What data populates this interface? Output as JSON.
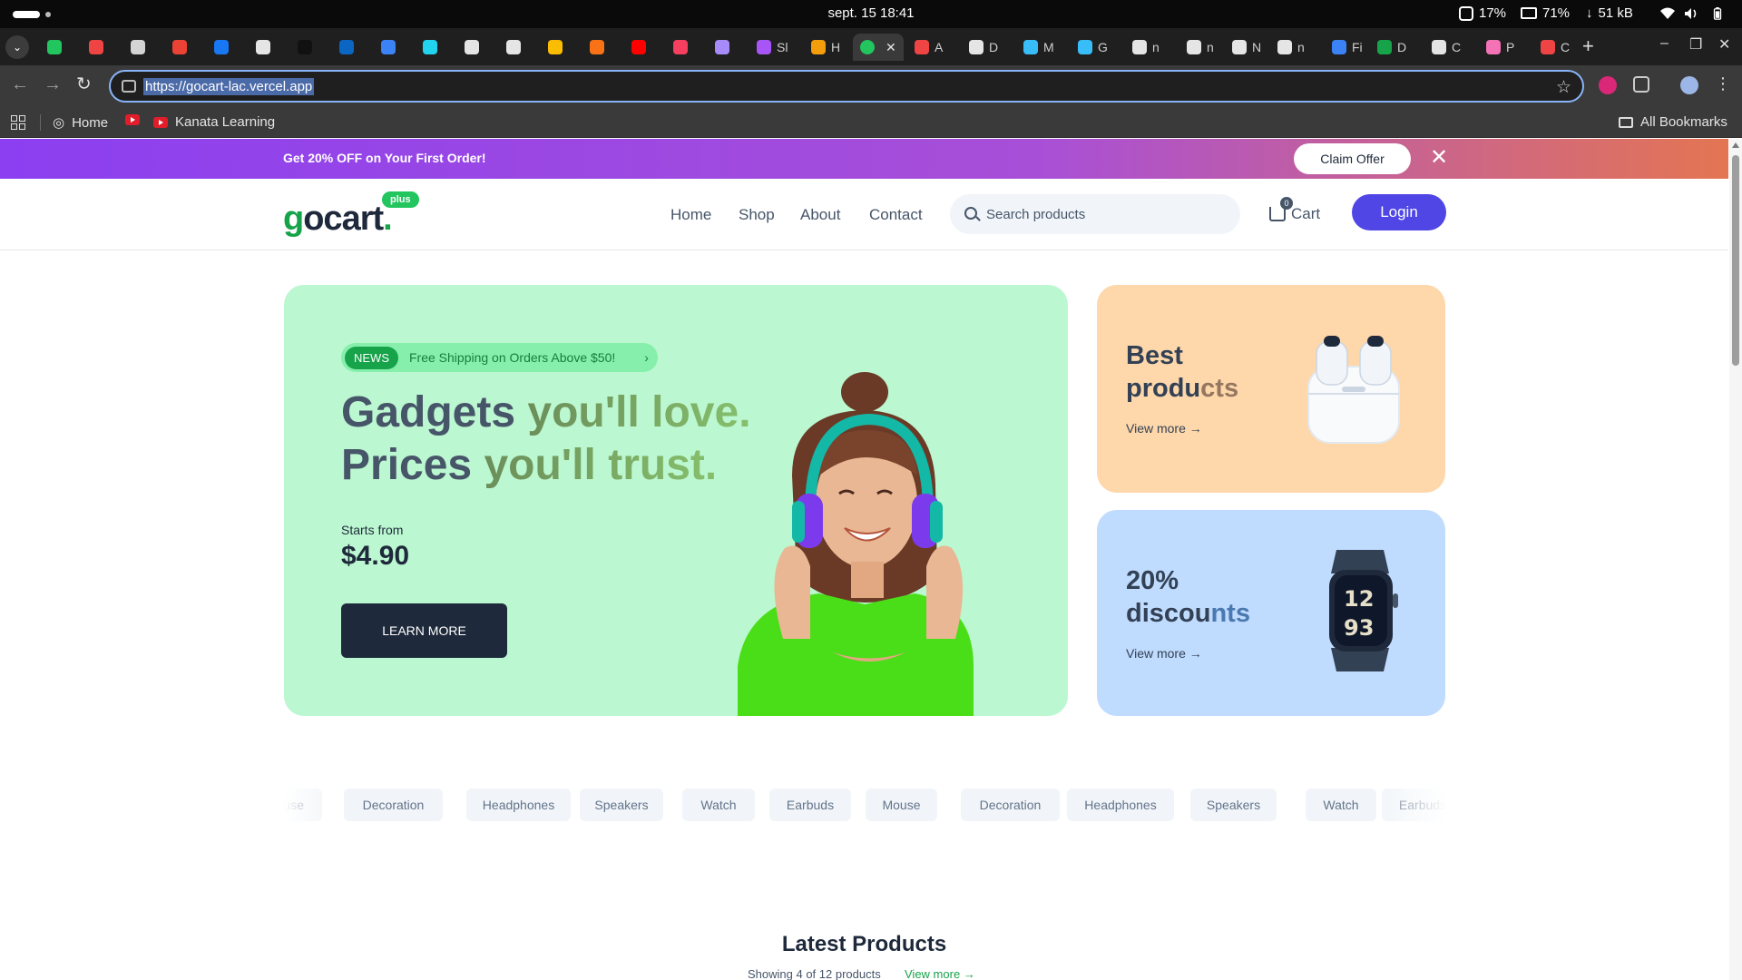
{
  "os": {
    "clock": "sept. 15  18:41",
    "cpu": "17%",
    "battery_like": "71%",
    "network": "51 kB"
  },
  "browser": {
    "tabs": [
      {
        "label": "",
        "color": "#22c55e"
      },
      {
        "label": "",
        "color": "#ef4444"
      },
      {
        "label": "",
        "color": "#d4d4d4"
      },
      {
        "label": "",
        "color": "#ea4335"
      },
      {
        "label": "",
        "color": "#1877f2"
      },
      {
        "label": "",
        "color": "#e5e5e5"
      },
      {
        "label": "",
        "color": "#111111"
      },
      {
        "label": "",
        "color": "#0a66c2"
      },
      {
        "label": "",
        "color": "#3b82f6"
      },
      {
        "label": "",
        "color": "#22d3ee"
      },
      {
        "label": "",
        "color": "#e5e5e5"
      },
      {
        "label": "",
        "color": "#e5e5e5"
      },
      {
        "label": "",
        "color": "#fbbc04"
      },
      {
        "label": "",
        "color": "#f97316"
      },
      {
        "label": "",
        "color": "#ff0000"
      },
      {
        "label": "",
        "color": "#f43f5e"
      },
      {
        "label": "",
        "color": "#a78bfa"
      },
      {
        "label": "Sl",
        "color": "#a855f7"
      },
      {
        "label": "H",
        "color": "#f59e0b"
      },
      {
        "label": "",
        "color": "#22c55e"
      },
      {
        "label": "A",
        "color": "#ef4444"
      },
      {
        "label": "D",
        "color": "#e5e5e5"
      },
      {
        "label": "M",
        "color": "#38bdf8"
      },
      {
        "label": "G",
        "color": "#38bdf8"
      },
      {
        "label": "n",
        "color": "#e5e5e5"
      },
      {
        "label": "n",
        "color": "#e5e5e5"
      },
      {
        "label": "N",
        "color": "#e5e5e5"
      },
      {
        "label": "n",
        "color": "#e5e5e5"
      },
      {
        "label": "Fi",
        "color": "#3b82f6"
      },
      {
        "label": "D",
        "color": "#16a34a"
      },
      {
        "label": "C",
        "color": "#e5e5e5"
      },
      {
        "label": "P",
        "color": "#f472b6"
      },
      {
        "label": "C",
        "color": "#ef4444"
      }
    ],
    "url": "https://gocart-lac.vercel.app",
    "bookmarks": {
      "home": "Home",
      "kanata": "Kanata Learning",
      "all": "All Bookmarks"
    }
  },
  "promo": {
    "message": "Get 20% OFF on Your First Order!",
    "claim": "Claim Offer",
    "close": "✕"
  },
  "nav": {
    "logo_main": "gocart",
    "logo_dot": ".",
    "logo_badge": "plus",
    "links": [
      "Home",
      "Shop",
      "About",
      "Contact"
    ],
    "search_placeholder": "Search products",
    "cart_label": "Cart",
    "cart_count": "0",
    "login": "Login"
  },
  "hero": {
    "news_tag": "NEWS",
    "news_text": "Free Shipping on Orders Above $50!",
    "headline_1a": "Gadgets ",
    "headline_1b": "you'll love.",
    "headline_2a": "Prices ",
    "headline_2b": "you'll trust.",
    "starts_from": "Starts from",
    "price": "$4.90",
    "cta": "LEARN MORE"
  },
  "cards": {
    "best": {
      "line1": "Best",
      "line2a": "produ",
      "line2b": "cts",
      "view_more": "View more"
    },
    "discount": {
      "line1": "20%",
      "line2a": "discou",
      "line2b": "nts",
      "view_more": "View more"
    }
  },
  "categories": [
    "Mouse",
    "Decoration",
    "Headphones",
    "Speakers",
    "Watch",
    "Earbuds",
    "Mouse",
    "Decoration",
    "Headphones",
    "Speakers",
    "Watch",
    "Earbuds"
  ],
  "latest": {
    "title": "Latest Products",
    "showing": "Showing 4 of 12 products",
    "view_more": "View more"
  }
}
